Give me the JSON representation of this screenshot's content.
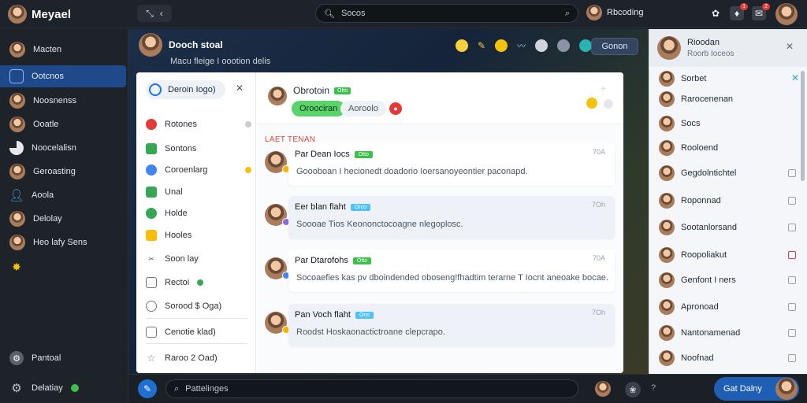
{
  "app": {
    "title": "Meyael"
  },
  "topbar": {
    "search_placeholder": "Socos",
    "user_name": "Rbcoding",
    "badges": [
      "1",
      "2"
    ]
  },
  "sidebar": {
    "items": [
      {
        "label": "Macten",
        "icon": "avatar"
      },
      {
        "label": "Ootcnos",
        "icon": "square-icon",
        "active": true
      },
      {
        "label": "Noosnenss",
        "icon": "avatar"
      },
      {
        "label": "Ooatle",
        "icon": "avatar"
      },
      {
        "label": "Noocelalisn",
        "icon": "pie-icon"
      },
      {
        "label": "Geroasting",
        "icon": "avatar"
      },
      {
        "label": "Aoola",
        "icon": "person-icon"
      },
      {
        "label": "Delolay",
        "icon": "avatar"
      },
      {
        "label": "Heo lafy Sens",
        "icon": "avatar"
      }
    ],
    "bottom": [
      {
        "label": "Pantoal",
        "icon": "gear-icon"
      },
      {
        "label": "Delatiay",
        "icon": "gear-icon"
      }
    ]
  },
  "channel": {
    "title": "Dooch stoal",
    "subtitle": "Macu fleige I oootion delis",
    "gen_button": "Gonon"
  },
  "modal": {
    "tab_label": "Deroin Iogo)",
    "menu": [
      {
        "label": "Rotones",
        "color": "#e53935"
      },
      {
        "label": "Sontons",
        "color": "#34a853"
      },
      {
        "label": "Coroenlarg",
        "color": "#4285f4"
      },
      {
        "label": "Unal",
        "color": "#34a853"
      },
      {
        "label": "Holde",
        "color": "#34a853"
      },
      {
        "label": "Hooles",
        "color": "#fbbc04"
      },
      {
        "label": "Soon lay",
        "color": "#777777"
      },
      {
        "label": "Rectoi",
        "color": "#777777"
      },
      {
        "label": "Sorood $ Oga)",
        "color": "#777777"
      },
      {
        "label": "Cenotie klad)",
        "color": "#777777"
      },
      {
        "label": "Raroo 2 Oad)",
        "color": "#777777"
      }
    ],
    "conversation": {
      "name": "Obrotoin",
      "tag": "Otto",
      "pill_active": "Oroociran",
      "pill_inactive": "Aoroolo",
      "pinned_label": "LAET TENAN",
      "messages": [
        {
          "name": "Par Dean Iocs",
          "tag": "Otto",
          "tag_color": "#3bc14a",
          "time": "70A",
          "text": "Goooboan I hecionedt doadorio Ioersanoyeontier paconapd.",
          "sub_color": "#f4b400"
        },
        {
          "name": "Eer blan flaht",
          "tag": "Orco",
          "tag_color": "#4fc3f7",
          "time": "7Oh",
          "text": "Soooae Tios Keononctocoagne nlegoplosc.",
          "sub_color": "#8e6bd8"
        },
        {
          "name": "Par Dtarofohs",
          "tag": "Otto",
          "tag_color": "#3bc14a",
          "time": "70A",
          "text": "Socoaefies kas pv dboindended oboseng!fhadtim terarne T Iocnt aneoake bocae.",
          "sub_color": "#4285f4"
        },
        {
          "name": "Pan Voch flaht",
          "tag": "Ono",
          "tag_color": "#4fc3f7",
          "time": "7Oh",
          "text": "Roodst Hoskaonactictroane clepcrapo.",
          "sub_color": "#f4b400"
        }
      ]
    }
  },
  "right_panel": {
    "title": "Rioodan",
    "subtitle": "Roorb Ioceos",
    "people": [
      {
        "name": "Sorbet",
        "check": false,
        "close": true
      },
      {
        "name": "Rarocenenan",
        "check": false
      },
      {
        "name": "Socs",
        "check": false
      },
      {
        "name": "Rooloend",
        "check": false
      },
      {
        "name": "Gegdolntichtel",
        "check": true
      },
      {
        "name": "Roponnad",
        "check": true
      },
      {
        "name": "Sootanlorsand",
        "check": true
      },
      {
        "name": "Roopoliakut",
        "check": true,
        "red": true
      },
      {
        "name": "Genfont I ners",
        "check": true
      },
      {
        "name": "Apronoad",
        "check": true
      },
      {
        "name": "Nantonamenad",
        "check": true
      },
      {
        "name": "Noofnad",
        "check": true
      }
    ]
  },
  "composer": {
    "placeholder": "Pattelinges",
    "get_button": "Gat Dalny"
  },
  "colors": {
    "accent": "#1e4a8c",
    "primary_blue": "#1f6fd1",
    "green": "#3bc14a",
    "red": "#e53935"
  }
}
